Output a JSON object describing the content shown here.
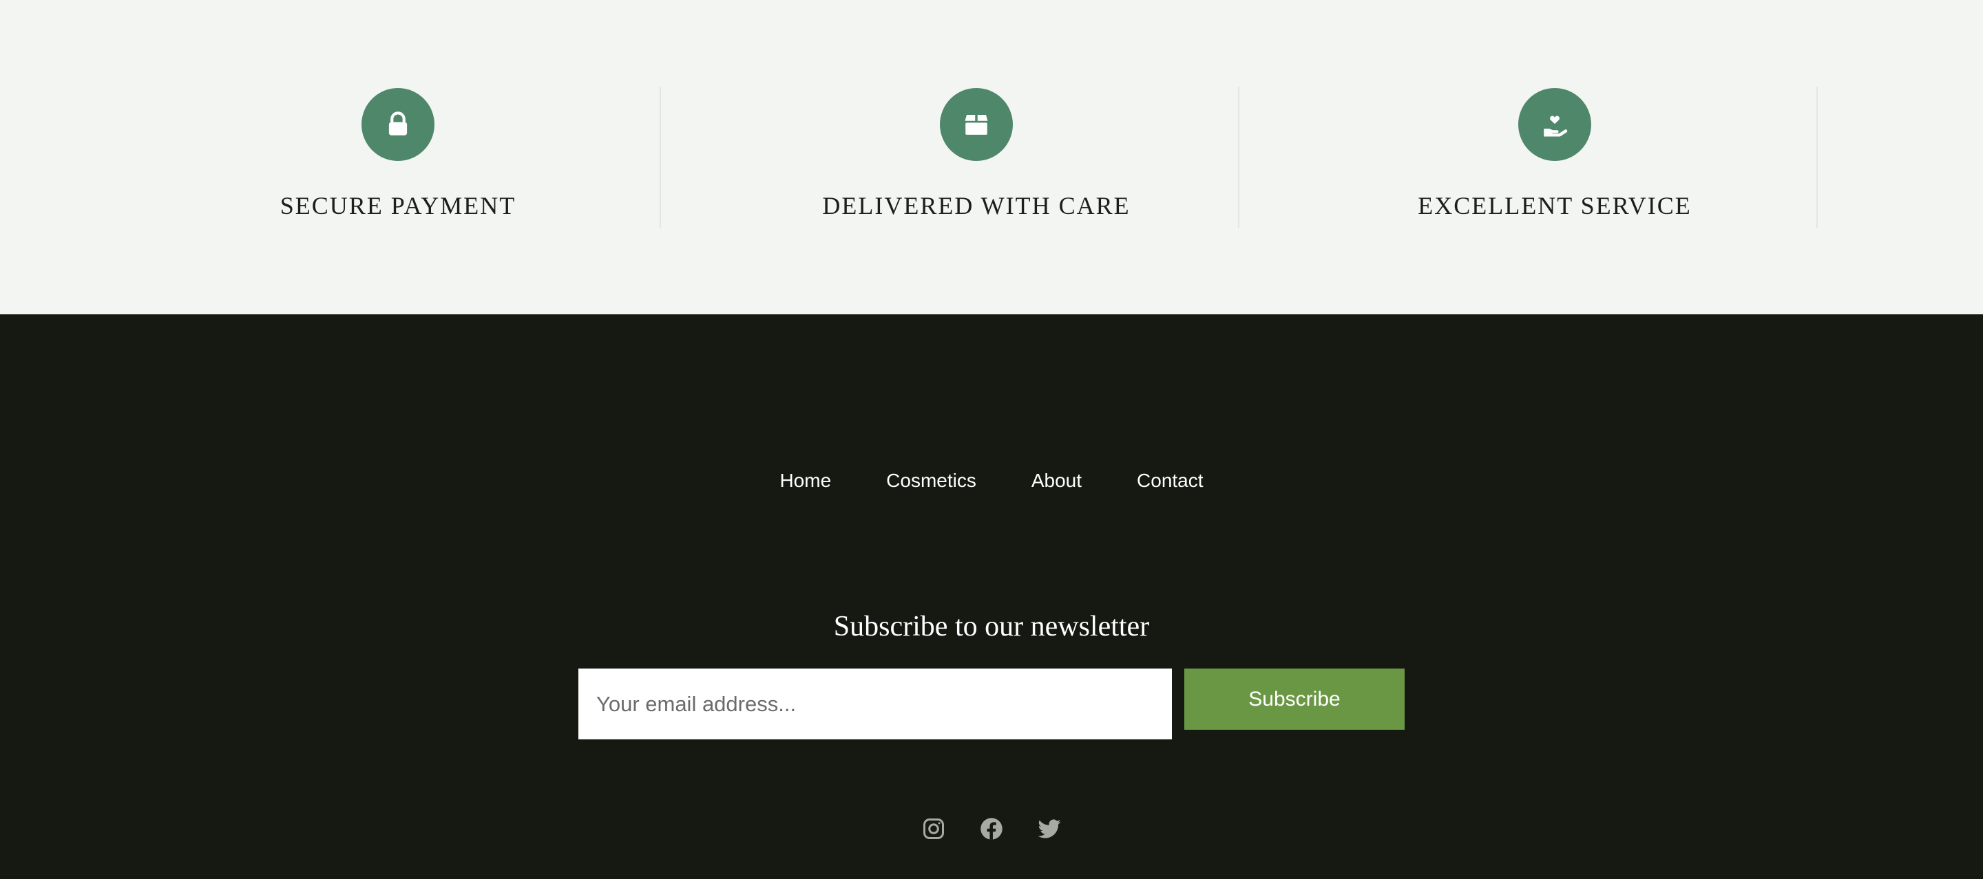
{
  "features": [
    {
      "icon": "lock-icon",
      "title": "SECURE PAYMENT"
    },
    {
      "icon": "box-icon",
      "title": "DELIVERED WITH CARE"
    },
    {
      "icon": "hand-heart-icon",
      "title": "EXCELLENT SERVICE"
    }
  ],
  "nav": {
    "items": [
      "Home",
      "Cosmetics",
      "About",
      "Contact"
    ]
  },
  "newsletter": {
    "title": "Subscribe to our newsletter",
    "email_placeholder": "Your email address...",
    "email_value": "",
    "subscribe_label": "Subscribe"
  },
  "social": [
    "instagram-icon",
    "facebook-icon",
    "twitter-icon"
  ],
  "colors": {
    "feature_bg": "#f3f5f2",
    "icon_circle": "#4e876a",
    "footer_bg": "#151912",
    "subscribe_button": "#6a9744",
    "social_icon": "#a7aaa3"
  }
}
